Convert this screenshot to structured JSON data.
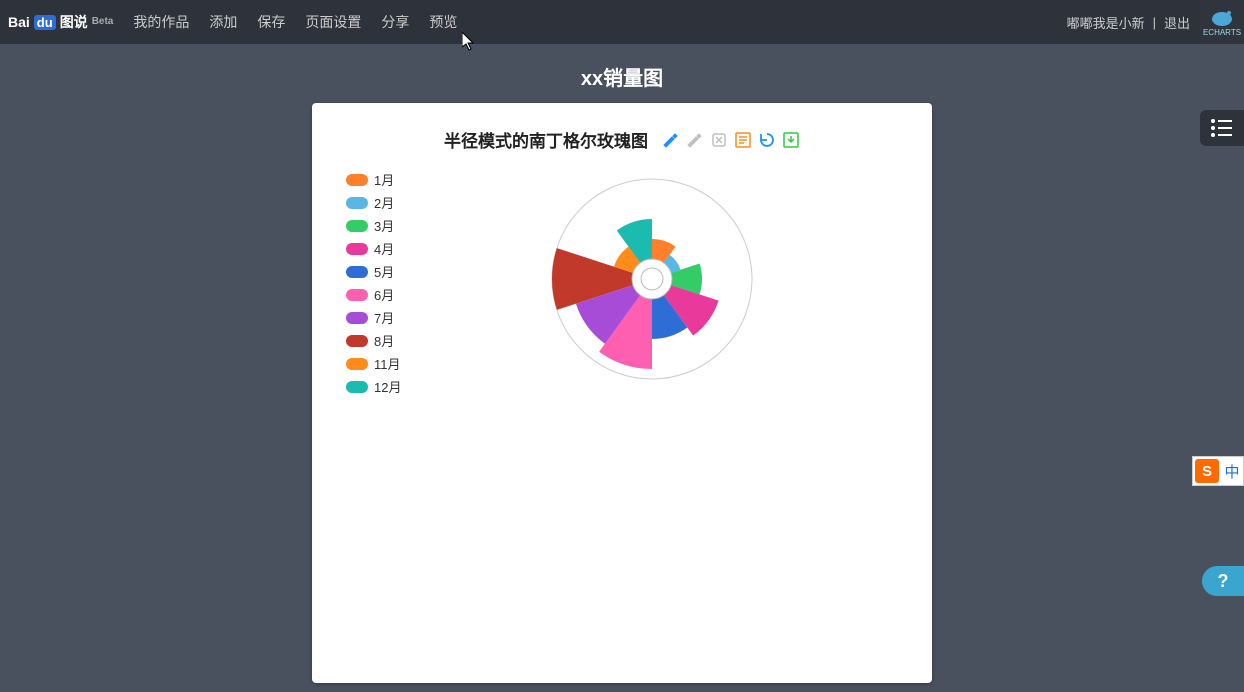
{
  "brand": {
    "left": "Bai",
    "mid": "du",
    "right": "图说",
    "beta": "Beta"
  },
  "nav": [
    "我的作品",
    "添加",
    "保存",
    "页面设置",
    "分享",
    "预览"
  ],
  "user": {
    "name": "嘟嘟我是小新",
    "logout": "退出"
  },
  "echarts_label": "ECHARTS",
  "page_title": "xx销量图",
  "toolbox_names": [
    "mark-icon",
    "mark-clear-icon",
    "mark-undo-icon",
    "data-view-icon",
    "restore-icon",
    "save-image-icon"
  ],
  "toolbox_colors": [
    "#1e90ff",
    "#c0c0c0",
    "#c0c0c0",
    "#ff8c1a",
    "#1e90ff",
    "#2ecc40"
  ],
  "ime": {
    "s": "S",
    "lang": "中"
  },
  "help": "?",
  "chart_data": {
    "type": "pie",
    "subtype": "nightingale-rose-radius",
    "title": "半径模式的南丁格尔玫瑰图",
    "inner_radius": 20,
    "outer_radius": 100,
    "legend_position": "left",
    "series": [
      {
        "name": "1月",
        "value": 10,
        "color": "#ff7f2a"
      },
      {
        "name": "2月",
        "value": 5,
        "color": "#59b7e6"
      },
      {
        "name": "3月",
        "value": 15,
        "color": "#33cc66"
      },
      {
        "name": "4月",
        "value": 25,
        "color": "#e93a9c"
      },
      {
        "name": "5月",
        "value": 20,
        "color": "#2e6dd6"
      },
      {
        "name": "6月",
        "value": 35,
        "color": "#ff5fb1"
      },
      {
        "name": "7月",
        "value": 30,
        "color": "#a64cd6"
      },
      {
        "name": "8月",
        "value": 40,
        "color": "#c0392b"
      },
      {
        "name": "11月",
        "value": 10,
        "color": "#ff8c1a"
      },
      {
        "name": "12月",
        "value": 20,
        "color": "#1bbbb0"
      }
    ]
  }
}
